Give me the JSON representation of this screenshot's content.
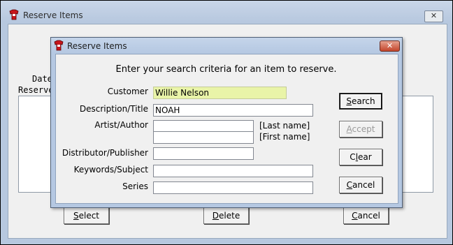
{
  "outer_window": {
    "title": "Reserve Items",
    "close_glyph": "✕",
    "date_label": "Date",
    "reserved_label": "Reserve",
    "buttons": {
      "select": {
        "pre": "",
        "key": "S",
        "post": "elect"
      },
      "delete": {
        "pre": "",
        "key": "D",
        "post": "elete"
      },
      "cancel": {
        "pre": "",
        "key": "C",
        "post": "ancel"
      }
    }
  },
  "dialog": {
    "title": "Reserve Items",
    "close_glyph": "✕",
    "prompt": "Enter your search criteria for an item to reserve.",
    "labels": {
      "customer": "Customer",
      "description": "Description/Title",
      "artist": "Artist/Author",
      "distributor": "Distributor/Publisher",
      "keywords": "Keywords/Subject",
      "series": "Series"
    },
    "values": {
      "customer": "Willie Nelson",
      "description": "NOAH",
      "artist_last": "",
      "artist_first": "",
      "distributor": "",
      "keywords": "",
      "series": ""
    },
    "hints": {
      "last_name": "[Last name]",
      "first_name": "[First name]"
    },
    "buttons": {
      "search": {
        "pre": "",
        "key": "S",
        "post": "earch"
      },
      "accept": {
        "pre": "",
        "key": "A",
        "post": "ccept"
      },
      "clear": {
        "pre": "C",
        "key": "l",
        "post": "ear"
      },
      "cancel": {
        "pre": "",
        "key": "C",
        "post": "ancel"
      }
    }
  },
  "colors": {
    "customer_highlight": "#e9f4a8",
    "title_bar": "#c5d5ea",
    "close_button": "#c3452b"
  },
  "icons": {
    "window_icon": "red-t-shirt-app-icon",
    "close": "close-icon"
  }
}
